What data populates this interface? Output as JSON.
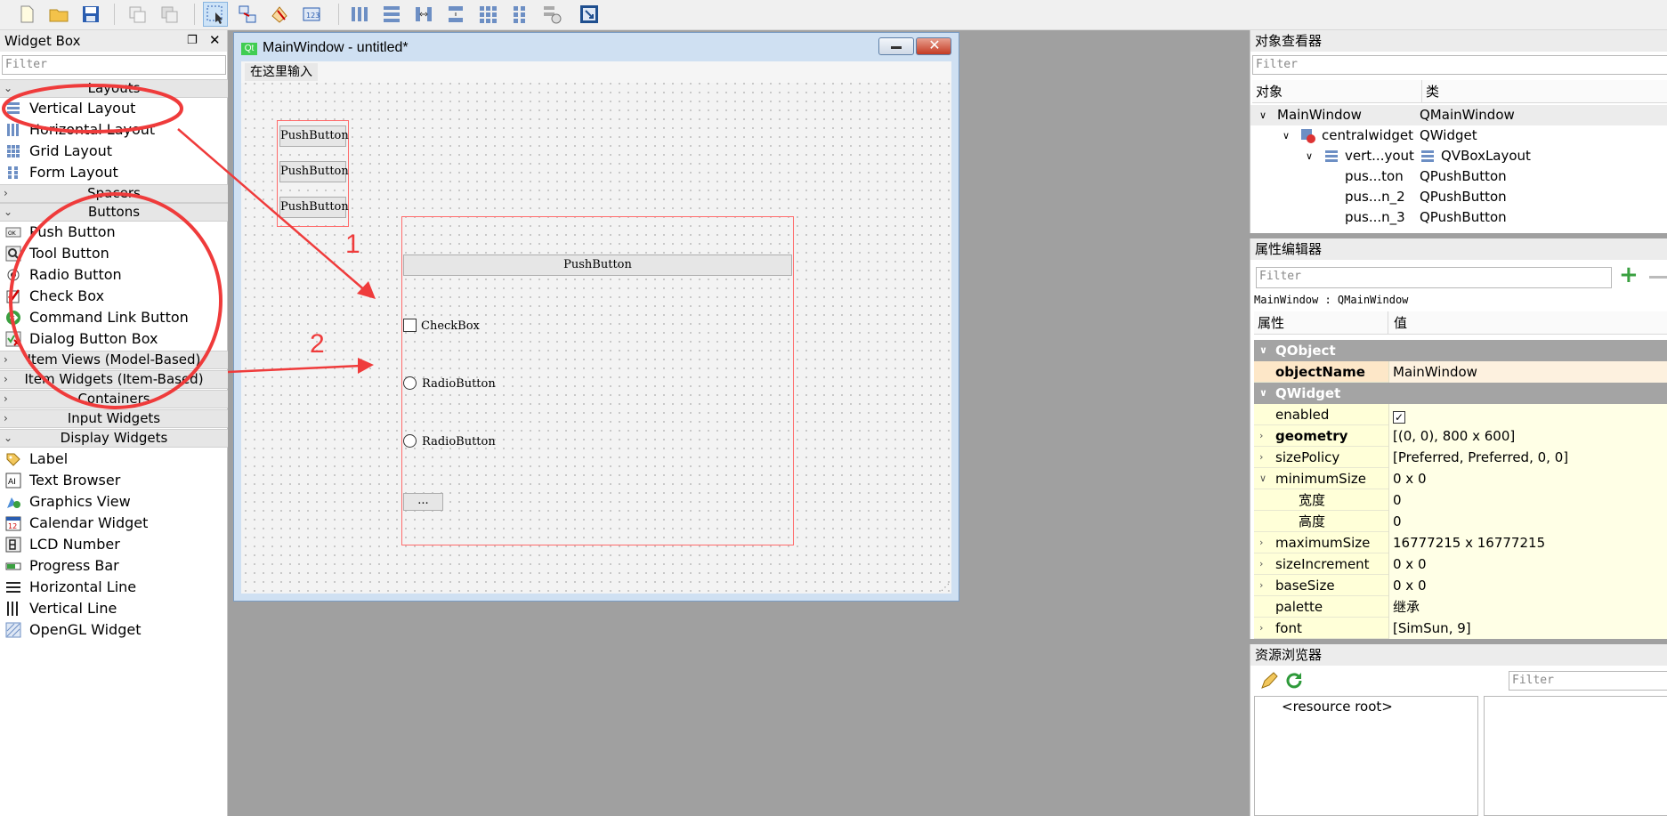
{
  "toolbar": {
    "icons": [
      "new-file-icon",
      "open-folder-icon",
      "save-icon",
      "copy-icon",
      "paste-icon",
      "edit-widgets-icon",
      "edit-signals-icon",
      "edit-buddies-icon",
      "edit-tab-order-icon",
      "lay-out-horizontally-icon",
      "lay-out-vertically-icon",
      "lay-out-horizontal-splitter-icon",
      "lay-out-vertical-splitter-icon",
      "lay-out-grid-icon",
      "lay-out-form-icon",
      "break-layout-icon",
      "adjust-size-icon"
    ]
  },
  "widget_box": {
    "title": "Widget Box",
    "filter_placeholder": "Filter",
    "categories": {
      "layouts": "Layouts",
      "spacers": "Spacers",
      "buttons": "Buttons",
      "item_views": "Item Views (Model-Based)",
      "item_widgets": "Item Widgets (Item-Based)",
      "containers": "Containers",
      "input_widgets": "Input Widgets",
      "display_widgets": "Display Widgets"
    },
    "layout_items": [
      "Vertical Layout",
      "Horizontal Layout",
      "Grid Layout",
      "Form Layout"
    ],
    "button_items": [
      "Push Button",
      "Tool Button",
      "Radio Button",
      "Check Box",
      "Command Link Button",
      "Dialog Button Box"
    ],
    "display_items": [
      "Label",
      "Text Browser",
      "Graphics View",
      "Calendar Widget",
      "LCD Number",
      "Progress Bar",
      "Horizontal Line",
      "Vertical Line",
      "OpenGL Widget"
    ],
    "calendar_icon_text": "12",
    "text_browser_icon_text": "AI"
  },
  "form": {
    "title": "MainWindow - untitled*",
    "qt_badge": "Qt",
    "menu_placeholder": "在这里输入",
    "small_buttons": [
      "PushButton",
      "PushButton",
      "PushButton"
    ],
    "wide_button": "PushButton",
    "checkbox_label": "CheckBox",
    "radio1_label": "RadioButton",
    "radio2_label": "RadioButton",
    "tool_button_label": "..."
  },
  "annotations": {
    "label1": "1",
    "label2": "2",
    "color": "#ef3b3b"
  },
  "object_inspector": {
    "title": "对象查看器",
    "filter_placeholder": "Filter",
    "col_object": "对象",
    "col_class": "类",
    "rows": [
      {
        "object": "MainWindow",
        "class": "QMainWindow"
      },
      {
        "object": "centralwidget",
        "class": "QWidget"
      },
      {
        "object": "vert...yout",
        "class": "QVBoxLayout"
      },
      {
        "object": "pus...ton",
        "class": "QPushButton"
      },
      {
        "object": "pus...n_2",
        "class": "QPushButton"
      },
      {
        "object": "pus...n_3",
        "class": "QPushButton"
      }
    ]
  },
  "property_editor": {
    "title": "属性编辑器",
    "filter_placeholder": "Filter",
    "context": "MainWindow : QMainWindow",
    "col_property": "属性",
    "col_value": "值",
    "group_qobject": "QObject",
    "group_qwidget": "QWidget",
    "props": [
      {
        "name": "objectName",
        "value": "MainWindow"
      },
      {
        "name": "enabled",
        "value": ""
      },
      {
        "name": "geometry",
        "value": "[(0, 0), 800 x 600]"
      },
      {
        "name": "sizePolicy",
        "value": "[Preferred, Preferred, 0, 0]"
      },
      {
        "name": "minimumSize",
        "value": "0 x 0"
      },
      {
        "name": "宽度",
        "value": "0"
      },
      {
        "name": "高度",
        "value": "0"
      },
      {
        "name": "maximumSize",
        "value": "16777215 x 16777215"
      },
      {
        "name": "sizeIncrement",
        "value": "0 x 0"
      },
      {
        "name": "baseSize",
        "value": "0 x 0"
      },
      {
        "name": "palette",
        "value": "继承"
      },
      {
        "name": "font",
        "value": "[SimSun, 9]"
      }
    ]
  },
  "resource_browser": {
    "title": "资源浏览器",
    "filter_placeholder": "Filter",
    "root": "<resource root>"
  }
}
